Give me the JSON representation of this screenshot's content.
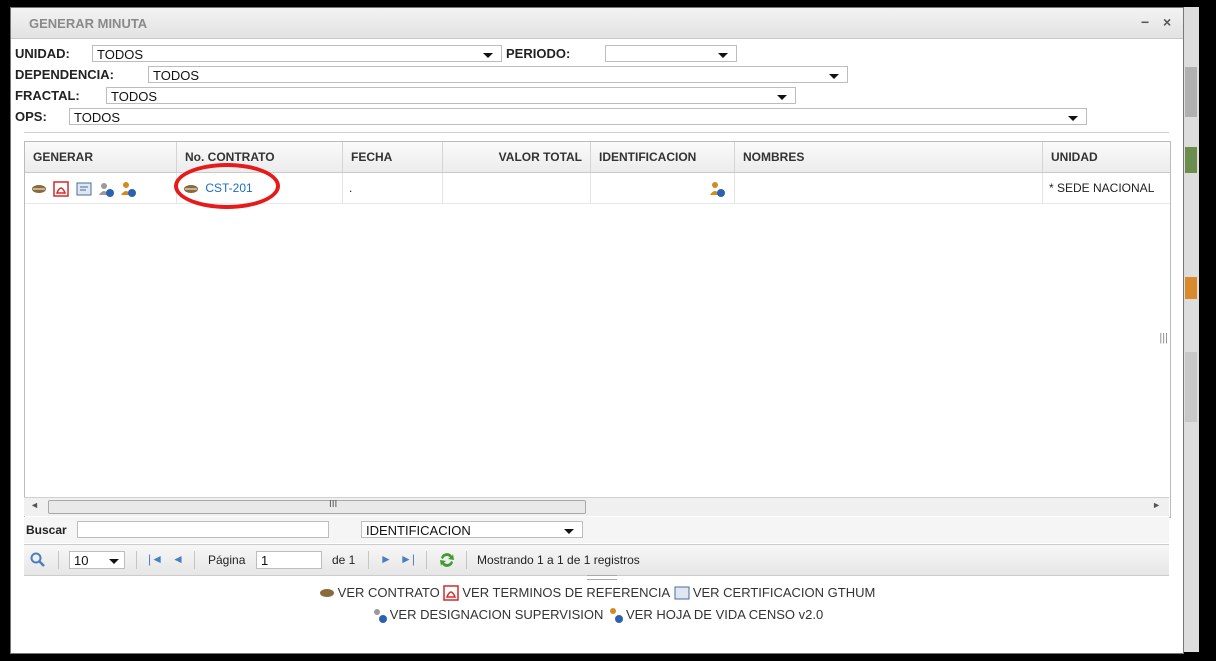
{
  "window": {
    "title": "GENERAR MINUTA",
    "minimize": "−",
    "close": "×"
  },
  "filters": {
    "unidad_label": "UNIDAD:",
    "unidad_value": "TODOS",
    "periodo_label": "PERIODO:",
    "periodo_value": "",
    "dependencia_label": "DEPENDENCIA:",
    "dependencia_value": "TODOS",
    "fractal_label": "FRACTAL:",
    "fractal_value": "TODOS",
    "ops_label": "OPS:",
    "ops_value": "TODOS"
  },
  "grid": {
    "columns": [
      "GENERAR",
      "No. CONTRATO",
      "FECHA",
      "VALOR TOTAL",
      "IDENTIFICACION",
      "NOMBRES",
      "UNIDAD"
    ],
    "rows": [
      {
        "contrato": "CST-201",
        "fecha": ".",
        "valor_total": "",
        "identificacion": "",
        "nombres": "",
        "unidad": "* SEDE NACIONAL"
      }
    ],
    "hscroll_grip": "III"
  },
  "search": {
    "label": "Buscar",
    "value": "",
    "field_value": "IDENTIFICACION"
  },
  "pager": {
    "page_size": "10",
    "page_label": "Página",
    "page_value": "1",
    "of_label": "de 1",
    "status": "Mostrando 1 a 1 de 1 registros"
  },
  "legend": {
    "ver_contrato": "VER CONTRATO",
    "ver_terminos": "VER TERMINOS DE REFERENCIA",
    "ver_certificacion": "VER CERTIFICACION GTHUM",
    "ver_designacion": "VER DESIGNACION SUPERVISION",
    "ver_hoja_vida": "VER HOJA DE VIDA CENSO v2.0"
  },
  "colors": {
    "link": "#1a6fc4",
    "highlight_circle": "#e51a1a",
    "pdf": "#d32a2a"
  }
}
